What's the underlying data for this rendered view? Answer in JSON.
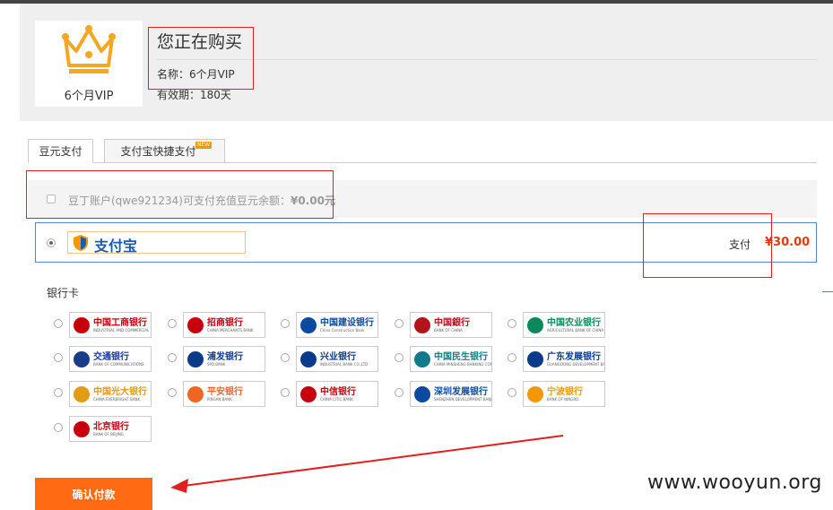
{
  "product": {
    "thumb_label": "6个月VIP",
    "title": "您正在购买",
    "name": "名称：6个月VIP",
    "validity": "有效期：180天"
  },
  "tabs": [
    {
      "label": "豆元支付",
      "active": true
    },
    {
      "label": "支付宝快捷支付",
      "active": false,
      "badge": "NEW"
    }
  ],
  "balance": {
    "text": "豆丁账户(qwe921234)可支付充值豆元余额：",
    "amount": "¥0.00元"
  },
  "alipay": {
    "logo_text": "支付宝",
    "pay_label": "支付",
    "amount": "¥30.00"
  },
  "bank_section": {
    "heading": "银行卡",
    "banks": [
      {
        "name": "中国工商银行",
        "sub": "INDUSTRIAL AND COMMERCIAL BANK OF CHINA",
        "icon": "icbc-icon",
        "color": "#c7000b"
      },
      {
        "name": "招商银行",
        "sub": "CHINA MERCHANTS BANK",
        "icon": "cmb-icon",
        "color": "#c7000b"
      },
      {
        "name": "中国建设银行",
        "sub": "China Construction Bank",
        "icon": "ccb-icon",
        "color": "#0a4a9f"
      },
      {
        "name": "中国銀行",
        "sub": "BANK OF CHINA",
        "icon": "boc-icon",
        "color": "#b5121b"
      },
      {
        "name": "中国农业银行",
        "sub": "AGRICULTURAL BANK OF CHINA",
        "icon": "abc-icon",
        "color": "#0a8a5a"
      },
      {
        "name": "交通银行",
        "sub": "BANK OF COMMUNICATIONS",
        "icon": "bocom-icon",
        "color": "#1a3a8a"
      },
      {
        "name": "浦发银行",
        "sub": "SPD BANK",
        "icon": "spdb-icon",
        "color": "#0a3a8a"
      },
      {
        "name": "兴业银行",
        "sub": "INDUSTRIAL BANK CO.,LTD",
        "icon": "cib-icon",
        "color": "#0a3a8a"
      },
      {
        "name": "中国民生银行",
        "sub": "CHINA MINSHENG BANKING CORP.,LTD",
        "icon": "cmbc-icon",
        "color": "#127a8a"
      },
      {
        "name": "广东发展银行",
        "sub": "GUANGDONG DEVELOPMENT BANK",
        "icon": "gdb-icon",
        "color": "#0a3a8a"
      },
      {
        "name": "中国光大银行",
        "sub": "CHINA EVERBRIGHT BANK",
        "icon": "ceb-icon",
        "color": "#e39a14"
      },
      {
        "name": "平安银行",
        "sub": "PINGAN BANK",
        "icon": "pingan-icon",
        "color": "#f26522"
      },
      {
        "name": "中信银行",
        "sub": "CHINA CITIC BANK",
        "icon": "citic-icon",
        "color": "#c7000b"
      },
      {
        "name": "深圳发展银行",
        "sub": "SHENZHEN DEVELOPMENT BANK",
        "icon": "sdb-icon",
        "color": "#0a4a9f"
      },
      {
        "name": "宁波银行",
        "sub": "BANK OF NINGBO",
        "icon": "nbcb-icon",
        "color": "#f39800"
      },
      {
        "name": "北京银行",
        "sub": "BANK OF BEIJING",
        "icon": "bob-icon",
        "color": "#c7000b"
      }
    ]
  },
  "confirm_label": "确认付款",
  "watermark": "www.wooyun.org",
  "colors": {
    "accent_orange": "#ff6a13",
    "price_red": "#e8380d",
    "annotation_red": "#e02020",
    "crown_gold": "#f5a623"
  }
}
